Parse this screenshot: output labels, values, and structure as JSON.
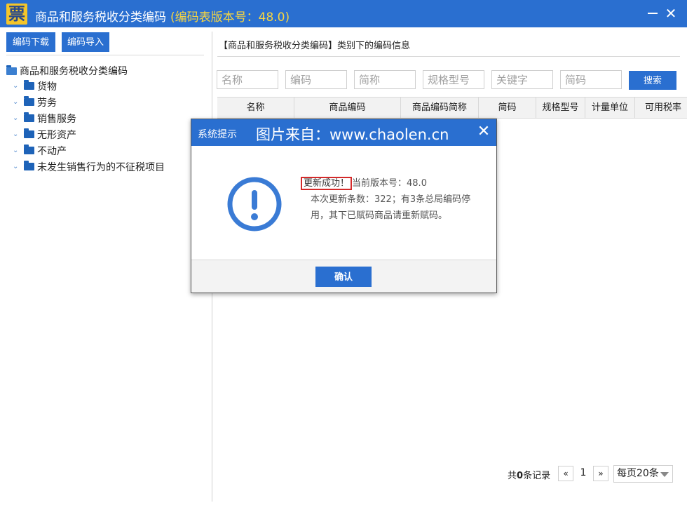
{
  "app": {
    "logo_char": "票",
    "title": "商品和服务税收分类编码",
    "version_text": "(编码表版本号：48.0)"
  },
  "toolbar": {
    "download_label": "编码下载",
    "import_label": "编码导入"
  },
  "tree": {
    "root_label": "商品和服务税收分类编码",
    "children": [
      "货物",
      "劳务",
      "销售服务",
      "无形资产",
      "不动产",
      "未发生销售行为的不征税项目"
    ]
  },
  "right": {
    "section_title": "【商品和服务税收分类编码】类别下的编码信息",
    "search_placeholders": [
      "名称",
      "编码",
      "简称",
      "规格型号",
      "关键字",
      "简码"
    ],
    "search_label": "搜索",
    "columns": [
      "名称",
      "商品编码",
      "商品编码简称",
      "简码",
      "规格型号",
      "计量单位",
      "可用税率"
    ]
  },
  "pager": {
    "total_prefix": "共",
    "total_count": "0",
    "total_suffix": "条记录",
    "prev": "«",
    "page": "1",
    "next": "»",
    "per_page": "每页20条"
  },
  "dialog": {
    "title": "系统提示",
    "watermark": "图片来自：www.chaolen.cn",
    "close_symbol": "✕",
    "success": "更新成功！",
    "current_version": "当前版本号：48.0",
    "detail": "本次更新条数：322；有3条总局编码停用，其下已赋码商品请重新赋码。",
    "ok_label": "确认"
  },
  "colors": {
    "primary": "#2a6fd0",
    "logo_bg": "#f5c62a",
    "version_text": "#f8d640",
    "highlight_border": "#d42a2a",
    "alert_icon": "#3a7bd5"
  },
  "icons": [
    "app-logo",
    "minimize-icon",
    "close-icon",
    "folder-icon",
    "expand-chevron-icon",
    "alert-icon"
  ]
}
